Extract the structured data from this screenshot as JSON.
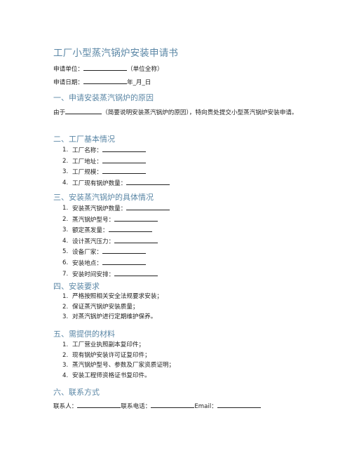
{
  "title": "工厂小型蒸汽锅炉安装申请书",
  "header_fields": [
    {
      "label": "申请单位：",
      "suffix": "（单位全称）"
    },
    {
      "label": "申请日期：",
      "suffix": "年_月_日"
    }
  ],
  "sections": [
    {
      "heading": "一、申请安装蒸汽锅炉的原因",
      "paragraph_prefix": "由于",
      "paragraph_suffix": "（简要说明安装蒸汽锅炉的原因），特向贵处提交小型蒸汽锅炉安装申请。"
    },
    {
      "heading": "二、工厂基本情况",
      "items": [
        "工厂名称：",
        "工厂地址：",
        "工厂规模：",
        "工厂现有锅炉数量："
      ]
    },
    {
      "heading": "三、安装蒸汽锅炉的具体情况",
      "items": [
        "安装蒸汽锅炉数量：",
        "蒸汽锅炉型号：",
        "额定蒸发量：",
        "设计蒸汽压力：",
        "设备厂家：",
        "安装地点：",
        "安装时间安排："
      ]
    },
    {
      "heading": "四、安装要求",
      "items": [
        "严格按照相关安全法规要求安装；",
        "保证蒸汽锅炉安装质量；",
        "对蒸汽锅炉进行定期维护保养。"
      ]
    },
    {
      "heading": "五、需提供的材料",
      "items": [
        "工厂营业执照副本复印件；",
        "现有锅炉安装许可证复印件；",
        "蒸汽锅炉型号、参数及厂家资质证明；",
        "安装工程师资格证书复印件。"
      ]
    },
    {
      "heading": "六、联系方式",
      "contact": {
        "person": "联系人：",
        "phone": "联系电话：",
        "email": "Email："
      }
    }
  ],
  "numbers": [
    "1.",
    "2.",
    "3.",
    "4.",
    "5.",
    "6.",
    "7."
  ]
}
